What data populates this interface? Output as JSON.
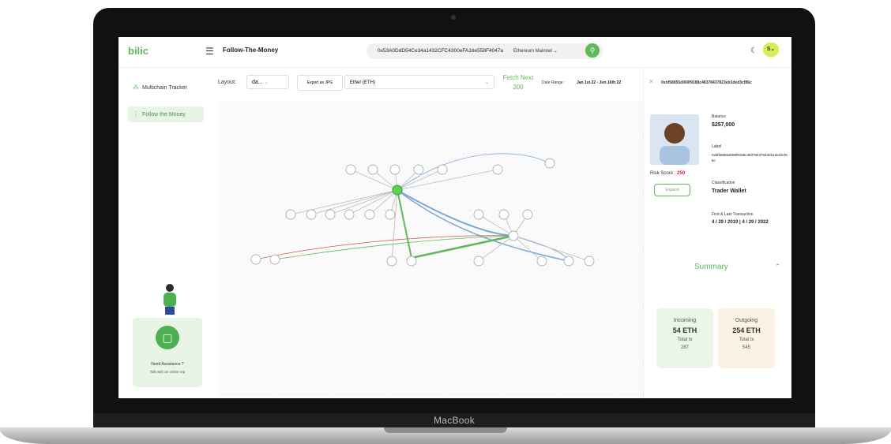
{
  "device": {
    "brand_label": "MacBook"
  },
  "header": {
    "logo": "bilic",
    "title": "Follow-The-Money",
    "search_address": "0x53A0DdD54Ce34a1432CFC4300eFA16e558F4047a",
    "network": "Ethereum Mainnet",
    "avatar_initial": "S"
  },
  "sidebar": {
    "items": [
      {
        "label": "Multichain Tracker",
        "icon": "multichain-icon",
        "active": false
      },
      {
        "label": "Follow the Money",
        "icon": "flow-icon",
        "active": true
      }
    ],
    "assist": {
      "title": "Need Assistance ?",
      "subtitle": "Talk with an online rep"
    }
  },
  "toolbar": {
    "layout_label": "Layout:",
    "layout_value": "da...",
    "export_label": "Export as JPG",
    "asset": "Ether (ETH)",
    "fetch_label": "Fetch Next",
    "fetch_count": "200",
    "date_range_label": "Date Range :",
    "date_range_value": "Jan 1st 22 - Jun 16th 22"
  },
  "panel": {
    "address": "0xbf58855d069f9188c48378437823eb1ded3cf86c",
    "risk_label": "Risk Score :",
    "risk_value": "250",
    "expand_label": "Expand",
    "balance_label": "Balance",
    "balance_value": "$257,000",
    "label_label": "Label",
    "label_value": "0xbf58855d069f9188c48378437823eb1ded3cf86c",
    "classification_label": "Classification",
    "classification_value": "Trader Wallet",
    "tx_label": "First & Last Transaction",
    "tx_value": "4 / 29 / 2019 | 4 / 29 / 2022",
    "summary_label": "Summary",
    "incoming": {
      "title": "Incoming",
      "amount": "54 ETH",
      "tx_label": "Total tx",
      "tx_count": "287"
    },
    "outgoing": {
      "title": "Outgoing",
      "amount": "254 ETH",
      "tx_label": "Total tx",
      "tx_count": "545"
    }
  },
  "colors": {
    "accent": "#5fb85a",
    "risk": "#dd2233",
    "incoming_bg": "#eaf6e7",
    "outgoing_bg": "#fbf2e3"
  }
}
